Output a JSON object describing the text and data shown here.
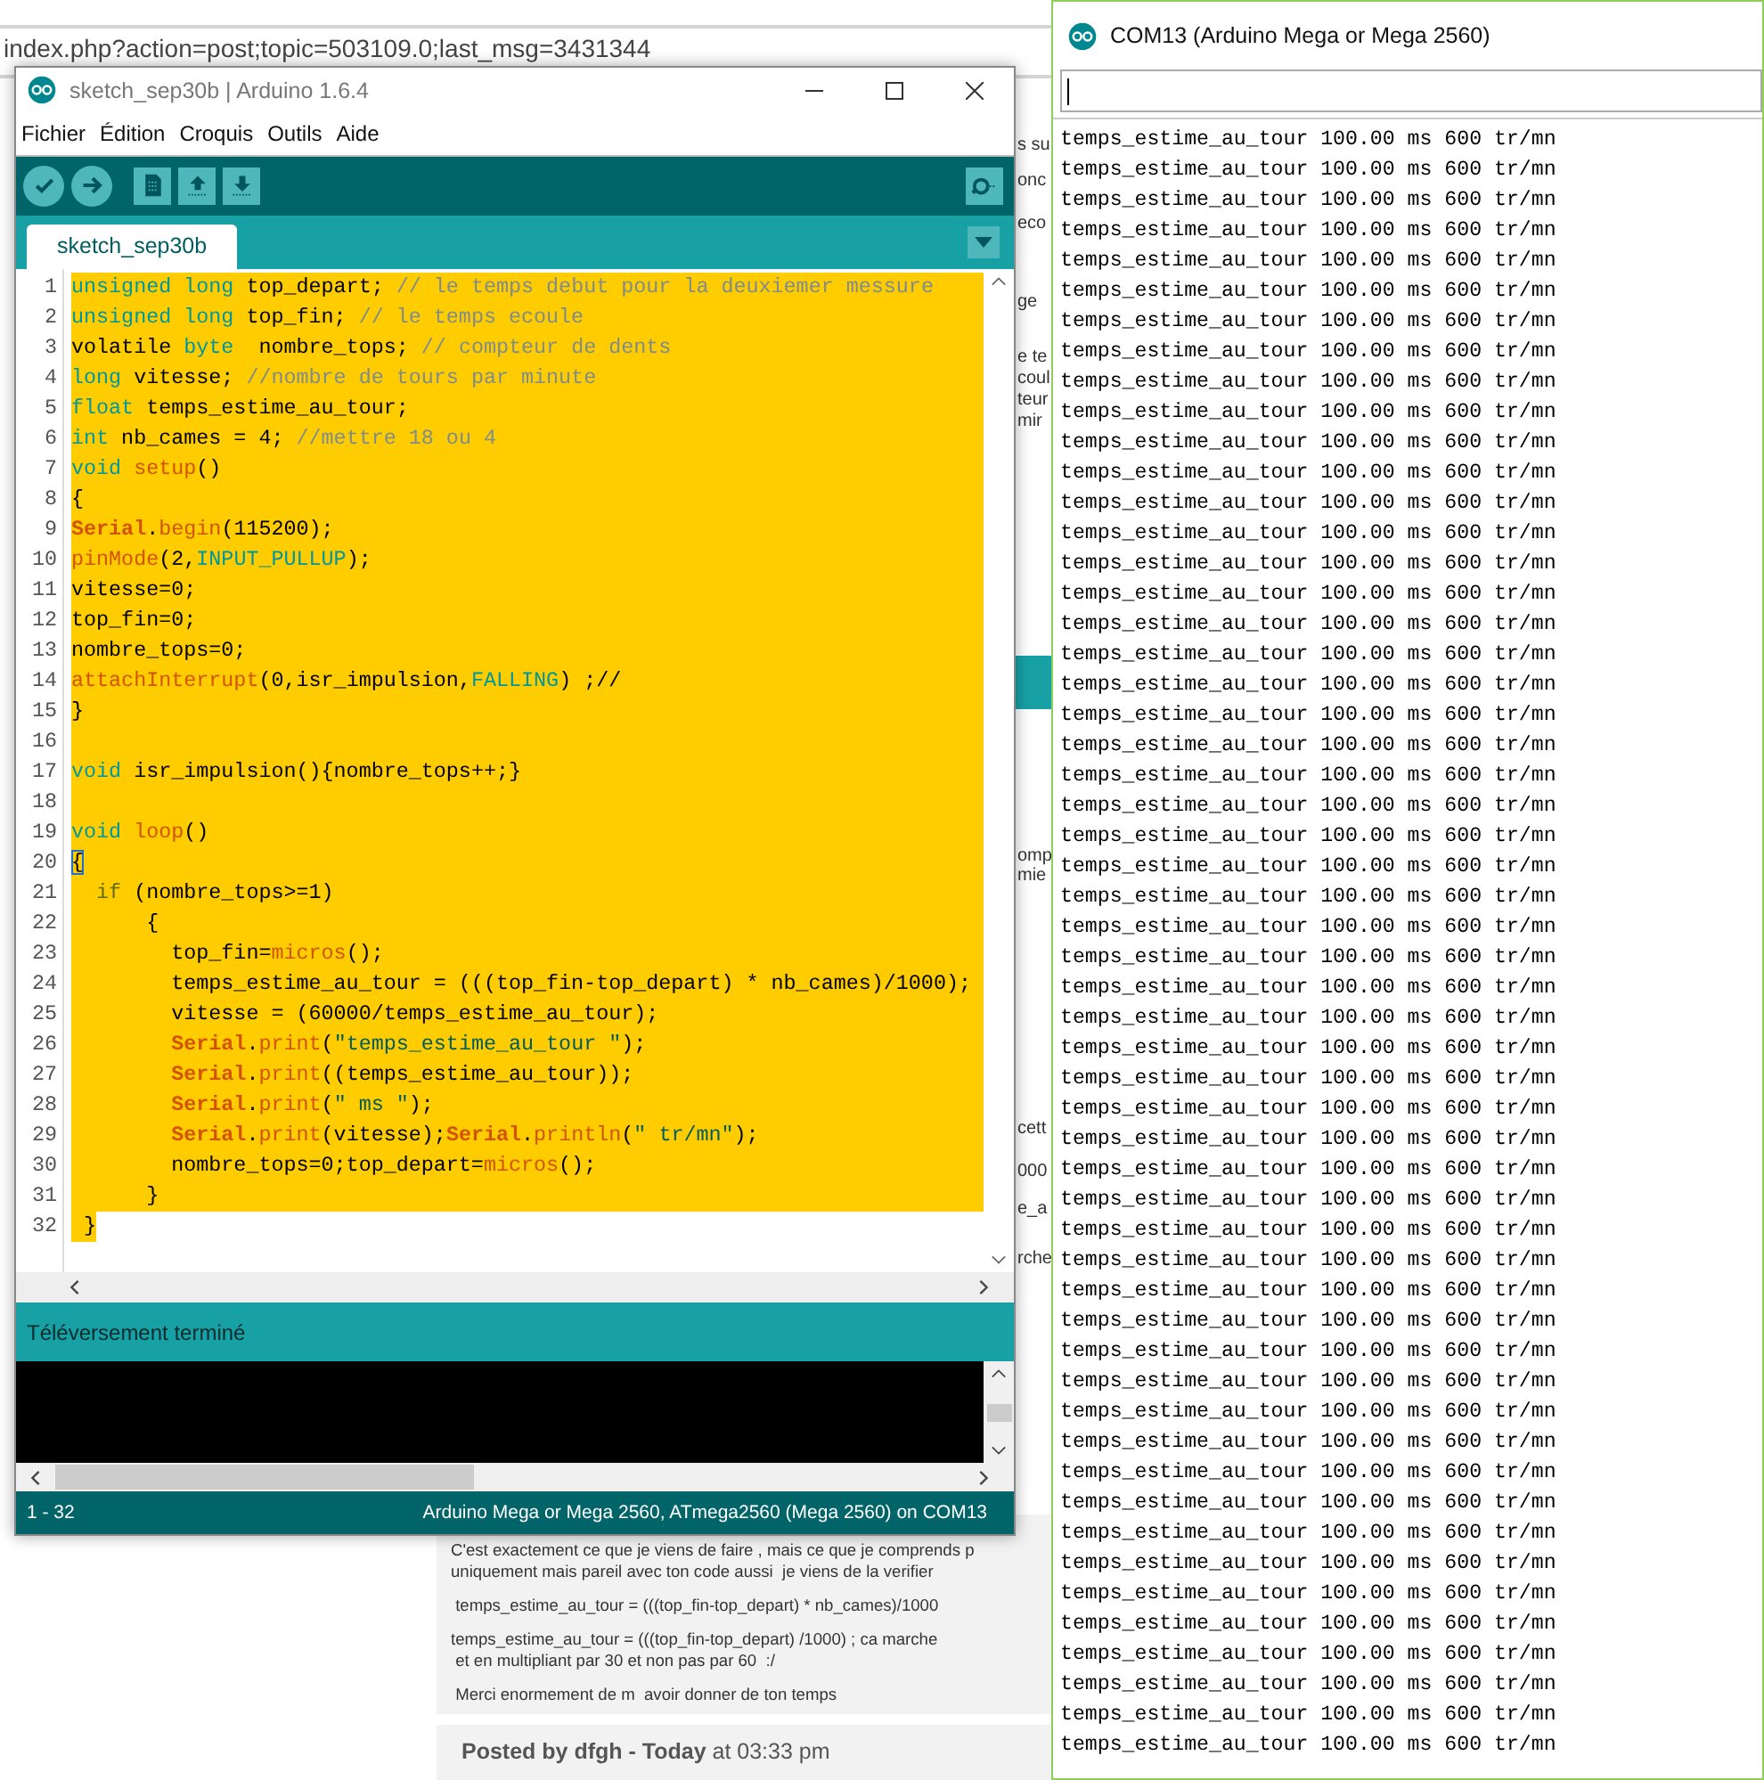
{
  "browser": {
    "address": "index.php?action=post;topic=503109.0;last_msg=3431344",
    "side_fragments": [
      "s su",
      "onc",
      "eco",
      "ge",
      "e te",
      "coul",
      "teur",
      "mir",
      "omp",
      "mie",
      "cett",
      "000",
      "e_a",
      "rche"
    ],
    "post_lines": [
      "C'est exactement ce que je viens de faire , mais ce que je comprends p",
      "uniquement mais pareil avec ton code aussi  je viens de la verifier",
      " temps_estime_au_tour = (((top_fin-top_depart) * nb_cames)/1000",
      "temps_estime_au_tour = (((top_fin-top_depart) /1000) ; ca marche",
      " et en multipliant par 30 et non pas par 60  :/",
      " Merci enormement de m  avoir donner de ton temps"
    ],
    "posted_by": "**Posted by dfgh - Today** at 03:33 pm"
  },
  "ide": {
    "title": "sketch_sep30b | Arduino 1.6.4",
    "menu": [
      "Fichier",
      "Édition",
      "Croquis",
      "Outils",
      "Aide"
    ],
    "toolbar": [
      {
        "kind": "verify"
      },
      {
        "kind": "upload"
      },
      {
        "kind": "new"
      },
      {
        "kind": "open"
      },
      {
        "kind": "save"
      }
    ],
    "tabs": [
      {
        "label": "sketch_sep30b",
        "selected": true
      }
    ],
    "lines": [
      {
        "n": "1",
        "selected": true,
        "tokens": [
          {
            "kind": "kw",
            "text": "unsigned long"
          },
          {
            "kind": "plain",
            "text": " top_depart; "
          },
          {
            "kind": "comment",
            "text": "// le temps debut pour la deuxiemer messure"
          }
        ]
      },
      {
        "n": "2",
        "selected": true,
        "tokens": [
          {
            "kind": "kw",
            "text": "unsigned long"
          },
          {
            "kind": "plain",
            "text": " top_fin; "
          },
          {
            "kind": "comment",
            "text": "// le temps ecoule"
          }
        ]
      },
      {
        "n": "3",
        "selected": true,
        "tokens": [
          {
            "kind": "plain",
            "text": "volatile "
          },
          {
            "kind": "kw",
            "text": "byte"
          },
          {
            "kind": "plain",
            "text": "  nombre_tops; "
          },
          {
            "kind": "comment",
            "text": "// compteur de dents"
          }
        ]
      },
      {
        "n": "4",
        "selected": true,
        "tokens": [
          {
            "kind": "kw",
            "text": "long"
          },
          {
            "kind": "plain",
            "text": " vitesse; "
          },
          {
            "kind": "comment",
            "text": "//nombre de tours par minute"
          }
        ]
      },
      {
        "n": "5",
        "selected": true,
        "tokens": [
          {
            "kind": "kw",
            "text": "float"
          },
          {
            "kind": "plain",
            "text": " temps_estime_au_tour;"
          }
        ]
      },
      {
        "n": "6",
        "selected": true,
        "tokens": [
          {
            "kind": "kw",
            "text": "int"
          },
          {
            "kind": "plain",
            "text": " nb_cames = 4; "
          },
          {
            "kind": "comment",
            "text": "//mettre 18 ou 4"
          }
        ]
      },
      {
        "n": "7",
        "selected": true,
        "tokens": [
          {
            "kind": "kw",
            "text": "void "
          },
          {
            "kind": "fn",
            "text": "setup"
          },
          {
            "kind": "plain",
            "text": "()"
          }
        ]
      },
      {
        "n": "8",
        "selected": true,
        "tokens": [
          {
            "kind": "plain",
            "text": "{"
          }
        ]
      },
      {
        "n": "9",
        "selected": true,
        "tokens": [
          {
            "kind": "cls",
            "text": "Serial"
          },
          {
            "kind": "plain",
            "text": "."
          },
          {
            "kind": "fn",
            "text": "begin"
          },
          {
            "kind": "plain",
            "text": "(115200);"
          }
        ]
      },
      {
        "n": "10",
        "selected": true,
        "tokens": [
          {
            "kind": "fn",
            "text": "pinMode"
          },
          {
            "kind": "plain",
            "text": "(2,"
          },
          {
            "kind": "kw",
            "text": "INPUT_PULLUP"
          },
          {
            "kind": "plain",
            "text": ");"
          }
        ]
      },
      {
        "n": "11",
        "selected": true,
        "tokens": [
          {
            "kind": "plain",
            "text": "vitesse=0;"
          }
        ]
      },
      {
        "n": "12",
        "selected": true,
        "tokens": [
          {
            "kind": "plain",
            "text": "top_fin=0;"
          }
        ]
      },
      {
        "n": "13",
        "selected": true,
        "tokens": [
          {
            "kind": "plain",
            "text": "nombre_tops=0;"
          }
        ]
      },
      {
        "n": "14",
        "selected": true,
        "tokens": [
          {
            "kind": "fn",
            "text": "attachInterrupt"
          },
          {
            "kind": "plain",
            "text": "(0,isr_impulsion,"
          },
          {
            "kind": "kw",
            "text": "FALLING"
          },
          {
            "kind": "plain",
            "text": ") ;//"
          }
        ]
      },
      {
        "n": "15",
        "selected": true,
        "tokens": [
          {
            "kind": "plain",
            "text": "}"
          }
        ]
      },
      {
        "n": "16",
        "selected": true
      },
      {
        "n": "17",
        "selected": true,
        "tokens": [
          {
            "kind": "kw",
            "text": "void"
          },
          {
            "kind": "plain",
            "text": " isr_impulsion(){nombre_tops++;}"
          }
        ]
      },
      {
        "n": "18",
        "selected": true
      },
      {
        "n": "19",
        "selected": true,
        "tokens": [
          {
            "kind": "kw",
            "text": "void "
          },
          {
            "kind": "fn",
            "text": "loop"
          },
          {
            "kind": "plain",
            "text": "()"
          }
        ]
      },
      {
        "n": "20",
        "selected": true,
        "tokens": [
          {
            "kind": "match",
            "text": "{"
          }
        ]
      },
      {
        "n": "21",
        "selected": true,
        "tokens": [
          {
            "kind": "ctl",
            "text": "  if"
          },
          {
            "kind": "plain",
            "text": " (nombre_tops>=1)"
          }
        ]
      },
      {
        "n": "22",
        "selected": true,
        "tokens": [
          {
            "kind": "plain",
            "text": "      {"
          }
        ]
      },
      {
        "n": "23",
        "selected": true,
        "tokens": [
          {
            "kind": "plain",
            "text": "        top_fin="
          },
          {
            "kind": "fn",
            "text": "micros"
          },
          {
            "kind": "plain",
            "text": "();"
          }
        ]
      },
      {
        "n": "24",
        "selected": true,
        "tokens": [
          {
            "kind": "plain",
            "text": "        temps_estime_au_tour = (((top_fin-top_depart) * nb_cames)/1000);"
          }
        ]
      },
      {
        "n": "25",
        "selected": true,
        "tokens": [
          {
            "kind": "plain",
            "text": "        vitesse = (60000/temps_estime_au_tour);"
          }
        ]
      },
      {
        "n": "26",
        "selected": true,
        "tokens": [
          {
            "kind": "cls",
            "text": "        Serial"
          },
          {
            "kind": "plain",
            "text": "."
          },
          {
            "kind": "fn",
            "text": "print"
          },
          {
            "kind": "plain",
            "text": "("
          },
          {
            "kind": "str",
            "text": "\"temps_estime_au_tour \""
          },
          {
            "kind": "plain",
            "text": ");"
          }
        ]
      },
      {
        "n": "27",
        "selected": true,
        "tokens": [
          {
            "kind": "cls",
            "text": "        Serial"
          },
          {
            "kind": "plain",
            "text": "."
          },
          {
            "kind": "fn",
            "text": "print"
          },
          {
            "kind": "plain",
            "text": "((temps_estime_au_tour));"
          }
        ]
      },
      {
        "n": "28",
        "selected": true,
        "tokens": [
          {
            "kind": "cls",
            "text": "        Serial"
          },
          {
            "kind": "plain",
            "text": "."
          },
          {
            "kind": "fn",
            "text": "print"
          },
          {
            "kind": "plain",
            "text": "("
          },
          {
            "kind": "str",
            "text": "\" ms \""
          },
          {
            "kind": "plain",
            "text": ");"
          }
        ]
      },
      {
        "n": "29",
        "selected": true,
        "tokens": [
          {
            "kind": "cls",
            "text": "        Serial"
          },
          {
            "kind": "plain",
            "text": "."
          },
          {
            "kind": "fn",
            "text": "print"
          },
          {
            "kind": "plain",
            "text": "(vitesse);"
          },
          {
            "kind": "cls",
            "text": "Serial"
          },
          {
            "kind": "plain",
            "text": "."
          },
          {
            "kind": "fn",
            "text": "println"
          },
          {
            "kind": "plain",
            "text": "("
          },
          {
            "kind": "str",
            "text": "\" tr/mn\""
          },
          {
            "kind": "plain",
            "text": ");"
          }
        ]
      },
      {
        "n": "30",
        "selected": true,
        "tokens": [
          {
            "kind": "plain",
            "text": "        nombre_tops=0;top_depart="
          },
          {
            "kind": "fn",
            "text": "micros"
          },
          {
            "kind": "plain",
            "text": "();"
          }
        ]
      },
      {
        "n": "31",
        "selected": true,
        "tokens": [
          {
            "kind": "plain",
            "text": "      }"
          }
        ]
      },
      {
        "n": "32",
        "selected": true,
        "tokens": [
          {
            "kind": "plain",
            "text": " }"
          }
        ]
      }
    ],
    "message": "Téléversement terminé",
    "footer_left": "1 - 32",
    "footer_right": "Arduino Mega or Mega 2560, ATmega2560 (Mega 2560) on COM13"
  },
  "monitor": {
    "title": "COM13 (Arduino Mega or Mega 2560)",
    "lines": [
      "temps_estime_au_tour 100.00 ms 600 tr/mn",
      "temps_estime_au_tour 100.00 ms 600 tr/mn",
      "temps_estime_au_tour 100.00 ms 600 tr/mn",
      "temps_estime_au_tour 100.00 ms 600 tr/mn",
      "temps_estime_au_tour 100.00 ms 600 tr/mn",
      "temps_estime_au_tour 100.00 ms 600 tr/mn",
      "temps_estime_au_tour 100.00 ms 600 tr/mn",
      "temps_estime_au_tour 100.00 ms 600 tr/mn",
      "temps_estime_au_tour 100.00 ms 600 tr/mn",
      "temps_estime_au_tour 100.00 ms 600 tr/mn",
      "temps_estime_au_tour 100.00 ms 600 tr/mn",
      "temps_estime_au_tour 100.00 ms 600 tr/mn",
      "temps_estime_au_tour 100.00 ms 600 tr/mn",
      "temps_estime_au_tour 100.00 ms 600 tr/mn",
      "temps_estime_au_tour 100.00 ms 600 tr/mn",
      "temps_estime_au_tour 100.00 ms 600 tr/mn",
      "temps_estime_au_tour 100.00 ms 600 tr/mn",
      "temps_estime_au_tour 100.00 ms 600 tr/mn",
      "temps_estime_au_tour 100.00 ms 600 tr/mn",
      "temps_estime_au_tour 100.00 ms 600 tr/mn",
      "temps_estime_au_tour 100.00 ms 600 tr/mn",
      "temps_estime_au_tour 100.00 ms 600 tr/mn",
      "temps_estime_au_tour 100.00 ms 600 tr/mn",
      "temps_estime_au_tour 100.00 ms 600 tr/mn",
      "temps_estime_au_tour 100.00 ms 600 tr/mn",
      "temps_estime_au_tour 100.00 ms 600 tr/mn",
      "temps_estime_au_tour 100.00 ms 600 tr/mn",
      "temps_estime_au_tour 100.00 ms 600 tr/mn",
      "temps_estime_au_tour 100.00 ms 600 tr/mn",
      "temps_estime_au_tour 100.00 ms 600 tr/mn",
      "temps_estime_au_tour 100.00 ms 600 tr/mn",
      "temps_estime_au_tour 100.00 ms 600 tr/mn",
      "temps_estime_au_tour 100.00 ms 600 tr/mn",
      "temps_estime_au_tour 100.00 ms 600 tr/mn",
      "temps_estime_au_tour 100.00 ms 600 tr/mn",
      "temps_estime_au_tour 100.00 ms 600 tr/mn",
      "temps_estime_au_tour 100.00 ms 600 tr/mn",
      "temps_estime_au_tour 100.00 ms 600 tr/mn",
      "temps_estime_au_tour 100.00 ms 600 tr/mn",
      "temps_estime_au_tour 100.00 ms 600 tr/mn",
      "temps_estime_au_tour 100.00 ms 600 tr/mn",
      "temps_estime_au_tour 100.00 ms 600 tr/mn",
      "temps_estime_au_tour 100.00 ms 600 tr/mn",
      "temps_estime_au_tour 100.00 ms 600 tr/mn",
      "temps_estime_au_tour 100.00 ms 600 tr/mn",
      "temps_estime_au_tour 100.00 ms 600 tr/mn",
      "temps_estime_au_tour 100.00 ms 600 tr/mn",
      "temps_estime_au_tour 100.00 ms 600 tr/mn",
      "temps_estime_au_tour 100.00 ms 600 tr/mn",
      "temps_estime_au_tour 100.00 ms 600 tr/mn",
      "temps_estime_au_tour 100.00 ms 600 tr/mn",
      "temps_estime_au_tour 100.00 ms 600 tr/mn",
      "temps_estime_au_tour 100.00 ms 600 tr/mn",
      "temps_estime_au_tour 100.00 ms 600 tr/mn"
    ]
  }
}
